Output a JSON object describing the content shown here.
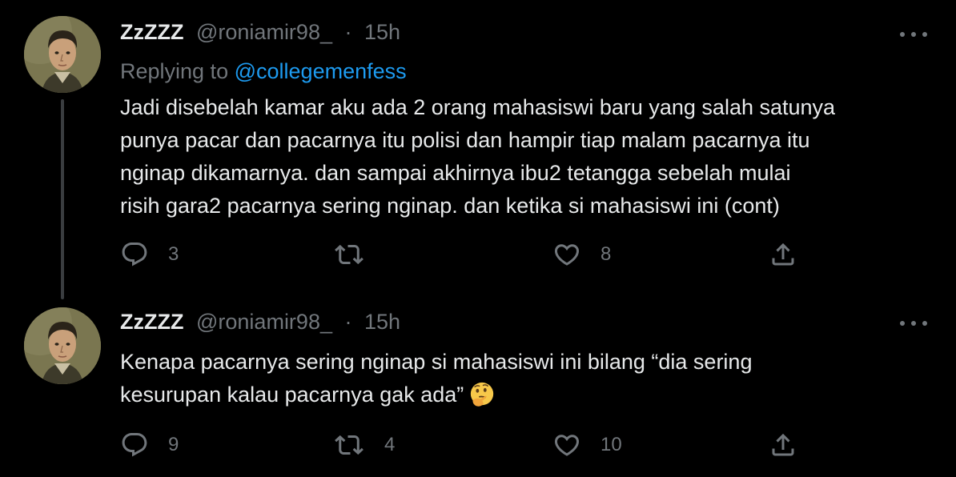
{
  "theme": {
    "background": "#000000",
    "text_primary": "#e7e9ea",
    "text_secondary": "#71767b",
    "link": "#1d9bf0",
    "thread_line": "#3a3d40"
  },
  "tweets": [
    {
      "display_name": "ZzZZZ",
      "handle": "@roniamir98_",
      "separator": "·",
      "time": "15h",
      "replying_prefix": "Replying to",
      "replying_to": "@collegemenfess",
      "text_lines": [
        "Jadi disebelah kamar aku ada 2 orang mahasiswi baru yang salah satunya",
        "punya pacar dan pacarnya itu polisi dan hampir tiap malam pacarnya itu",
        "nginap dikamarnya. dan sampai akhirnya ibu2 tetangga sebelah mulai",
        "risih gara2 pacarnya sering nginap. dan ketika si mahasiswi ini (cont)"
      ],
      "reply_count": "3",
      "retweet_count": "",
      "like_count": "8",
      "icons": [
        "reply-icon",
        "retweet-icon",
        "like-icon",
        "share-icon",
        "more-icon"
      ]
    },
    {
      "display_name": "ZzZZZ",
      "handle": "@roniamir98_",
      "separator": "·",
      "time": "15h",
      "text_lines": [
        "Kenapa pacarnya sering nginap si mahasiswi ini bilang “dia sering",
        "kesurupan kalau pacarnya gak ada”"
      ],
      "emoji": "thinking-face-emoji",
      "reply_count": "9",
      "retweet_count": "4",
      "like_count": "10",
      "icons": [
        "reply-icon",
        "retweet-icon",
        "like-icon",
        "share-icon",
        "more-icon"
      ]
    }
  ]
}
